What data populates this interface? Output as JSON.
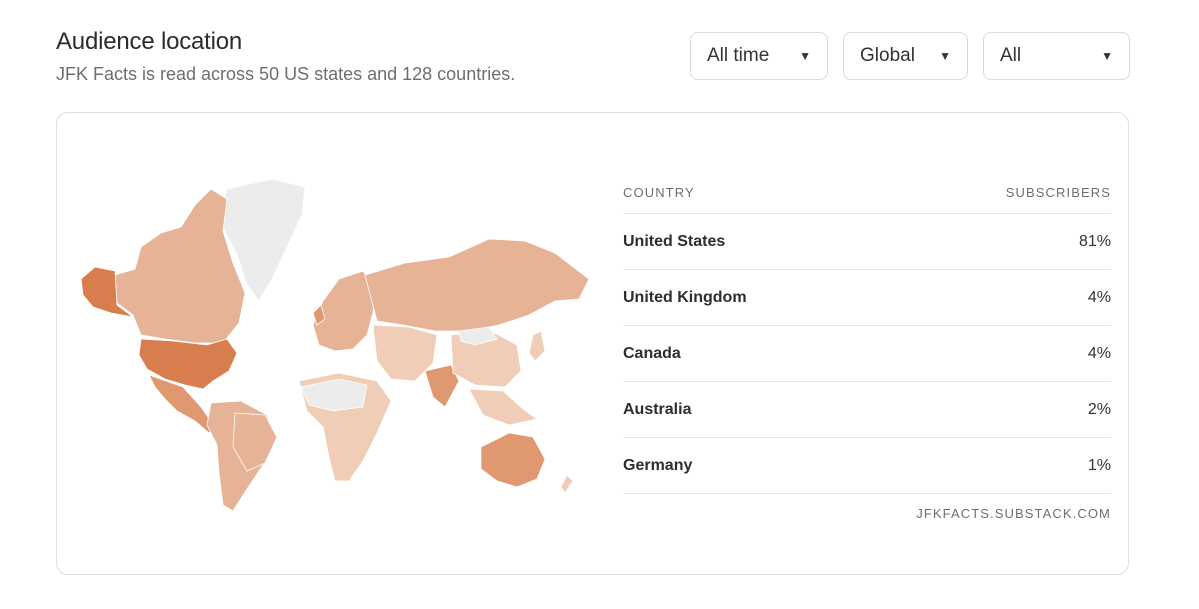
{
  "header": {
    "title": "Audience location",
    "subtitle": "JFK Facts is read across 50 US states and 128 countries."
  },
  "filters": [
    {
      "label": "All time",
      "icon": "caret-down-icon"
    },
    {
      "label": "Global",
      "icon": "caret-down-icon"
    },
    {
      "label": "All",
      "icon": "caret-down-icon"
    }
  ],
  "colors": {
    "top": "#d77d4e",
    "high": "#df986f",
    "mid": "#e7b397",
    "low": "#f0cdb6",
    "none": "#ececec"
  },
  "table": {
    "col_country": "COUNTRY",
    "col_subscribers": "SUBSCRIBERS",
    "rows": [
      {
        "country": "United States",
        "value": "81%"
      },
      {
        "country": "United Kingdom",
        "value": "4%"
      },
      {
        "country": "Canada",
        "value": "4%"
      },
      {
        "country": "Australia",
        "value": "2%"
      },
      {
        "country": "Germany",
        "value": "1%"
      }
    ],
    "source": "JFKFACTS.SUBSTACK.COM"
  }
}
